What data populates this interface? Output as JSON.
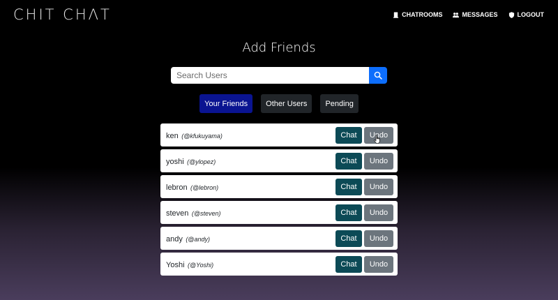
{
  "header": {
    "brand": "CHIT CHΛT",
    "nav": [
      {
        "label": "CHATROOMS",
        "icon": "chatrooms-icon"
      },
      {
        "label": "MESSAGES",
        "icon": "people-icon"
      },
      {
        "label": "LOGOUT",
        "icon": "shield-icon"
      }
    ]
  },
  "page": {
    "title": "Add Friends",
    "search": {
      "placeholder": "Search Users",
      "value": "",
      "icon": "search-icon"
    },
    "tabs": [
      {
        "label": "Your Friends",
        "active": true
      },
      {
        "label": "Other Users",
        "active": false
      },
      {
        "label": "Pending",
        "active": false
      }
    ]
  },
  "friends": [
    {
      "name": "ken",
      "handle": "(@kfukuyama)",
      "chat_label": "Chat",
      "undo_label": "Undo"
    },
    {
      "name": "yoshi",
      "handle": "(@ylopez)",
      "chat_label": "Chat",
      "undo_label": "Undo"
    },
    {
      "name": "lebron",
      "handle": "(@lebron)",
      "chat_label": "Chat",
      "undo_label": "Undo"
    },
    {
      "name": "steven",
      "handle": "(@steven)",
      "chat_label": "Chat",
      "undo_label": "Undo"
    },
    {
      "name": "andy",
      "handle": "(@andy)",
      "chat_label": "Chat",
      "undo_label": "Undo"
    },
    {
      "name": "Yoshi",
      "handle": "(@Yoshi)",
      "chat_label": "Chat",
      "undo_label": "Undo"
    }
  ],
  "colors": {
    "active_tab": "#0a1491",
    "inactive_tab": "#212529",
    "search_button": "#0d6efd",
    "chat_button": "#0c4a56",
    "undo_button": "#6c757d"
  }
}
